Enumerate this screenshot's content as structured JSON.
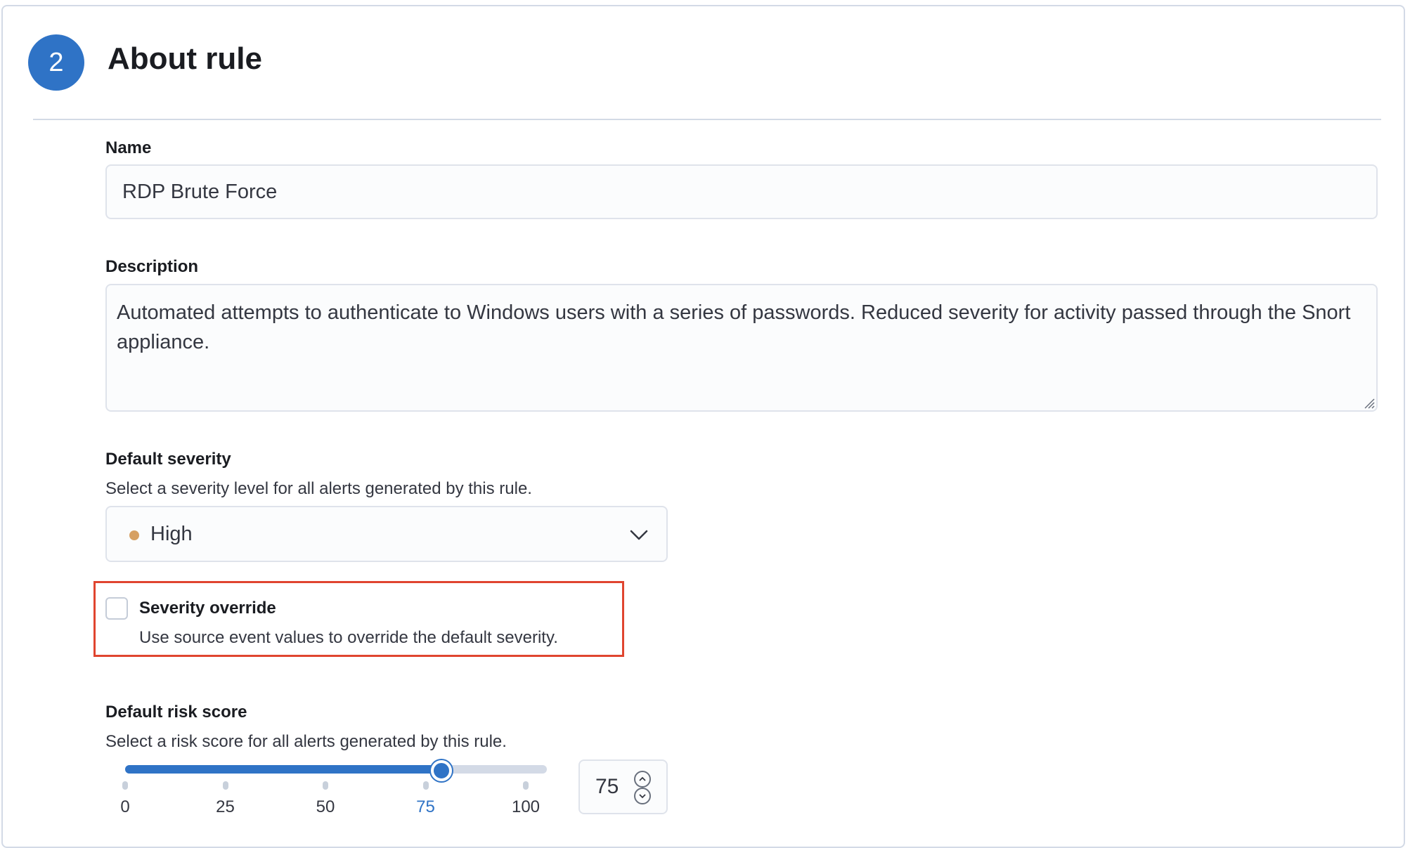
{
  "step": {
    "number": "2",
    "title": "About rule"
  },
  "name_field": {
    "label": "Name",
    "value": "RDP Brute Force"
  },
  "description_field": {
    "label": "Description",
    "value": "Automated attempts to authenticate to Windows users with a series of passwords. Reduced severity for activity passed through the Snort appliance."
  },
  "default_severity": {
    "label": "Default severity",
    "help": "Select a severity level for all alerts generated by this rule.",
    "selected": "High",
    "dot_color": "#d6a063",
    "icon": "chevron-down-icon"
  },
  "severity_override": {
    "label": "Severity override",
    "help": "Use source event values to override the default severity.",
    "checked": false,
    "highlight_color": "#e0452f"
  },
  "risk_score": {
    "label": "Default risk score",
    "help": "Select a risk score for all alerts generated by this rule.",
    "value": 75,
    "value_text": "75",
    "min": 0,
    "max": 100,
    "ticks": [
      "0",
      "25",
      "50",
      "75",
      "100"
    ],
    "accent_color": "#2f73c6"
  }
}
